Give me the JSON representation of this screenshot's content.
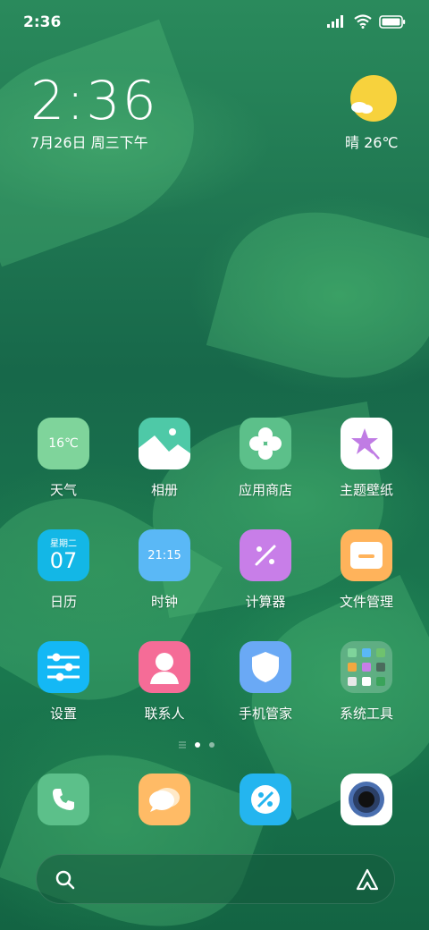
{
  "status_bar": {
    "time": "2:36",
    "icons": [
      "signal-icon",
      "wifi-icon",
      "battery-icon"
    ]
  },
  "clock_widget": {
    "time": "2:36",
    "date": "7月26日 周三下午"
  },
  "weather_widget": {
    "icon": "sunny-cloud-icon",
    "text": "晴 26℃"
  },
  "apps": [
    {
      "label": "天气",
      "icon": "weather-icon",
      "badge": "16℃",
      "color": "#7fd49b"
    },
    {
      "label": "相册",
      "icon": "gallery-icon",
      "color": "#4ec9a7"
    },
    {
      "label": "应用商店",
      "icon": "app-store-icon",
      "color": "#5cc08a"
    },
    {
      "label": "主题壁纸",
      "icon": "theme-icon",
      "color": "#ffffff"
    },
    {
      "label": "日历",
      "icon": "calendar-icon",
      "badge_top": "星期二",
      "badge": "07",
      "color": "#13b7e6"
    },
    {
      "label": "时钟",
      "icon": "clock-icon",
      "badge": "21:15",
      "color": "#5ab8f6"
    },
    {
      "label": "计算器",
      "icon": "calculator-icon",
      "color": "#c87ee8"
    },
    {
      "label": "文件管理",
      "icon": "file-manager-icon",
      "color": "#ffb35b"
    },
    {
      "label": "设置",
      "icon": "settings-icon",
      "color": "#14b8f5"
    },
    {
      "label": "联系人",
      "icon": "contacts-icon",
      "color": "#f56c97"
    },
    {
      "label": "手机管家",
      "icon": "security-icon",
      "color": "#6aa9f5"
    },
    {
      "label": "系统工具",
      "icon": "folder-icon",
      "color": "#5f9a80"
    }
  ],
  "dock": [
    {
      "icon": "phone-icon",
      "color": "#5cc08a"
    },
    {
      "icon": "messages-icon",
      "color": "#ffbb66"
    },
    {
      "icon": "browser-icon",
      "color": "#24b5ef"
    },
    {
      "icon": "camera-icon",
      "color": "#ffffff"
    }
  ]
}
